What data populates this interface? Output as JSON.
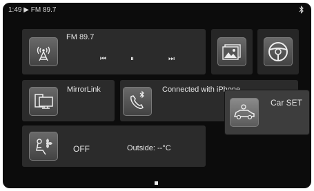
{
  "status_bar": {
    "time": "1:49",
    "source_indicator": "▶",
    "station": "FM 89.7",
    "bluetooth_icon": "bluetooth-icon"
  },
  "radio": {
    "title": "FM 89.7",
    "icon": "radio-antenna-icon",
    "prev": "⏮",
    "pause": "⏸",
    "next": "⏭"
  },
  "gallery": {
    "icon": "image-gallery-icon"
  },
  "steering": {
    "icon": "steering-wheel-icon"
  },
  "mirrorlink": {
    "label": "MirrorLink",
    "icon": "mirrorlink-icon"
  },
  "phone": {
    "status": "Connected with  iPhone",
    "icon": "bluetooth-phone-icon"
  },
  "car_set": {
    "label": "Car SET",
    "icon": "car-settings-icon"
  },
  "climate": {
    "state": "OFF",
    "outside": "Outside: --°C",
    "icon": "climate-fan-icon"
  },
  "pager": {
    "active_page": 1,
    "page_count": 1
  }
}
